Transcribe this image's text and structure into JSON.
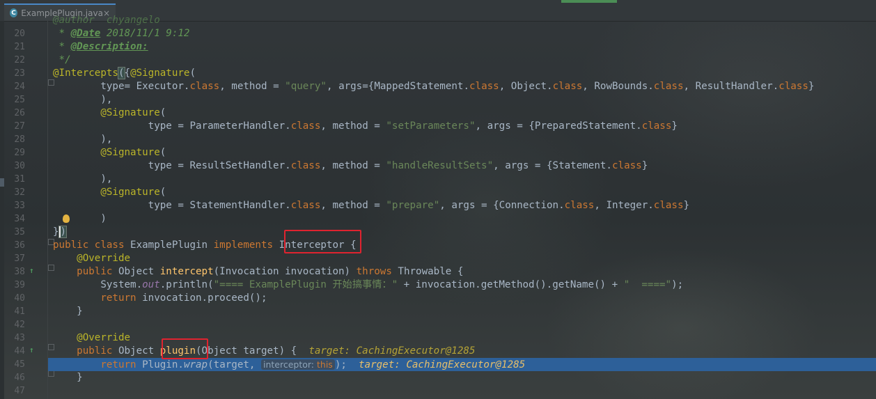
{
  "tab": {
    "icon_letter": "C",
    "title": "ExamplePlugin.java",
    "close_glyph": "×"
  },
  "line_numbers": [
    "20",
    "21",
    "22",
    "23",
    "24",
    "25",
    "26",
    "27",
    "28",
    "29",
    "30",
    "31",
    "32",
    "33",
    "34",
    "35",
    "36",
    "37",
    "38",
    "39",
    "40",
    "41",
    "42",
    "43",
    "44",
    "45",
    "46",
    "47"
  ],
  "code": {
    "l19_partial": "@author  chyangelo",
    "l20": {
      "star": " * ",
      "tag": "@Date",
      "text": " 2018/11/1 9:12"
    },
    "l21": {
      "star": " * ",
      "tag": "@Description:"
    },
    "l22": " */",
    "l23": {
      "ann": "@Intercepts",
      "brace": "(",
      "rest": "{",
      "sig": "@Signature",
      "open": "("
    },
    "l24": {
      "indent": "        ",
      "a": "type",
      "b": "= Executor.",
      "kw1": "class",
      "c": ", ",
      "method": "method",
      "d": " = ",
      "str": "\"query\"",
      "e": ", ",
      "args": "args",
      "f": "={MappedStatement.",
      "kw2": "class",
      "g": ", Object.",
      "kw3": "class",
      "h": ", RowBounds.",
      "kw4": "class",
      "i": ", ResultHandler.",
      "kw5": "class",
      "j": "}"
    },
    "l25": "        ),",
    "l26": {
      "indent": "        ",
      "sig": "@Signature",
      "open": "("
    },
    "l27": {
      "indent": "                ",
      "a": "type",
      "b": " = ParameterHandler.",
      "kw1": "class",
      "c": ", ",
      "method": "method",
      "d": " = ",
      "str": "\"setParameters\"",
      "e": ", ",
      "args": "args",
      "f": " = {PreparedStatement.",
      "kw2": "class",
      "g": "}"
    },
    "l28": "        ),",
    "l29": {
      "indent": "        ",
      "sig": "@Signature",
      "open": "("
    },
    "l30": {
      "indent": "                ",
      "a": "type",
      "b": " = ResultSetHandler.",
      "kw1": "class",
      "c": ", ",
      "method": "method",
      "d": " = ",
      "str": "\"handleResultSets\"",
      "e": ", ",
      "args": "args",
      "f": " = {Statement.",
      "kw2": "class",
      "g": "}"
    },
    "l31": "        ),",
    "l32": {
      "indent": "        ",
      "sig": "@Signature",
      "open": "("
    },
    "l33": {
      "indent": "                ",
      "a": "type",
      "b": " = StatementHandler.",
      "kw1": "class",
      "c": ", ",
      "method": "method",
      "d": " = ",
      "str": "\"prepare\"",
      "e": ", ",
      "args": "args",
      "f": " = {Connection.",
      "kw2": "class",
      "g": ", Integer.",
      "kw3": "class",
      "h": "}"
    },
    "l34": "        )",
    "l35": {
      "a": "}",
      "b": ")"
    },
    "l36": {
      "kw1": "public class",
      "a": " ExamplePlugin ",
      "kw2": "implements",
      "b": " Interceptor",
      "c": " {"
    },
    "l37": {
      "indent": "    ",
      "ann": "@Override"
    },
    "l38": {
      "indent": "    ",
      "kw1": "public",
      "a": " Object ",
      "fn": "intercept",
      "b": "(Invocation invocation) ",
      "kw2": "throws",
      "c": " Throwable {"
    },
    "l39": {
      "indent": "        ",
      "a": "System.",
      "fld": "out",
      "b": ".println(",
      "str": "\"==== ExamplePlugin 开始搞事情：\"",
      "c": " + invocation.getMethod().getName() + ",
      "str2": "\"  ====\"",
      "d": ");"
    },
    "l40": {
      "indent": "        ",
      "kw": "return",
      "a": " invocation.proceed();"
    },
    "l41": "    }",
    "l43": {
      "indent": "    ",
      "ann": "@Override"
    },
    "l44": {
      "indent": "    ",
      "kw": "public",
      "a": " Object ",
      "fn": "plugin",
      "b": "(Object target) {  ",
      "dbg": "target: CachingExecutor@1285"
    },
    "l45": {
      "indent": "        ",
      "kw": "return",
      "a": " Plugin.",
      "it": "wrap",
      "b": "(target, ",
      "hint": "interceptor:",
      "kw2": "this",
      "c": ");  ",
      "dbg": "target: CachingExecutor@1285"
    },
    "l46": "    }"
  }
}
